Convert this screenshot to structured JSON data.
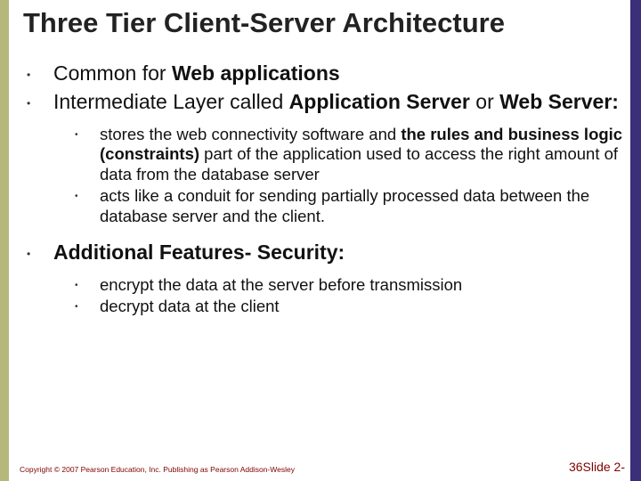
{
  "title": "Three Tier Client-Server Architecture",
  "bullets": {
    "b1_pre": "Common for ",
    "b1_bold": "Web applications",
    "b2_pre": "Intermediate Layer called ",
    "b2_bold": "Application Server",
    "b2_mid": " or ",
    "b2_bold2": "Web Server:",
    "b3_bold": "Additional Features- Security:"
  },
  "sublist1": {
    "s1_pre": "stores the web connectivity software and ",
    "s1_bold": "the rules and business logic (constraints)",
    "s1_post": " part of the application used to access the right amount of data from the database server",
    "s2": "acts like a conduit for sending partially processed data between the database server and the client."
  },
  "sublist2": {
    "s1": "encrypt the data at the server before transmission",
    "s2": "decrypt data at the client"
  },
  "footer": "Copyright © 2007 Pearson Education, Inc. Publishing as Pearson Addison-Wesley",
  "slide_number": "36Slide 2-"
}
